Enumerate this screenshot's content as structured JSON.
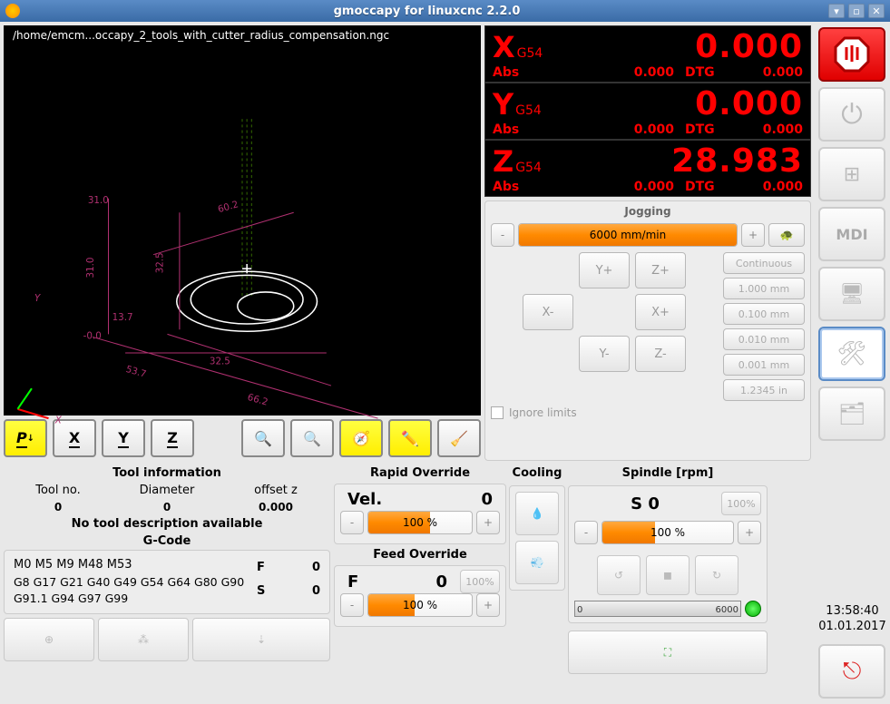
{
  "window": {
    "title": "gmoccapy for linuxcnc  2.2.0",
    "min": "▾",
    "restore": "▫",
    "close": "✕"
  },
  "preview": {
    "filepath": "/home/emcm...occapy_2_tools_with_cutter_radius_compensation.ngc",
    "dims": [
      "31.0",
      "31.0",
      "60.2",
      "32.5",
      "53.7",
      "32.5",
      "66.2",
      "13.7",
      "-0.0",
      "Y",
      "X"
    ]
  },
  "dro": {
    "rows": [
      {
        "axis": "X",
        "sub": "G54",
        "val": "0.000",
        "abs": "Abs",
        "v1": "0.000",
        "dtg": "DTG",
        "v2": "0.000"
      },
      {
        "axis": "Y",
        "sub": "G54",
        "val": "0.000",
        "abs": "Abs",
        "v1": "0.000",
        "dtg": "DTG",
        "v2": "0.000"
      },
      {
        "axis": "Z",
        "sub": "G54",
        "val": "28.983",
        "abs": "Abs",
        "v1": "0.000",
        "dtg": "DTG",
        "v2": "0.000"
      }
    ]
  },
  "jogging": {
    "title": "Jogging",
    "speed": "6000 mm/min",
    "fill": "100%",
    "minus": "-",
    "plus": "+",
    "btns": {
      "yp": "Y+",
      "zp": "Z+",
      "xm": "X-",
      "xp": "X+",
      "ym": "Y-",
      "zm": "Z-"
    },
    "steps": [
      "Continuous",
      "1.000 mm",
      "0.100 mm",
      "0.010 mm",
      "0.001 mm",
      "1.2345 in"
    ],
    "ignore": "Ignore limits"
  },
  "toolbar": {
    "p": "P",
    "x": "X",
    "y": "Y",
    "z": "Z"
  },
  "toolinfo": {
    "title": "Tool information",
    "hdr": {
      "no": "Tool no.",
      "dia": "Diameter",
      "off": "offset z"
    },
    "val": {
      "no": "0",
      "dia": "0",
      "off": "0.000"
    },
    "desc": "No tool description available"
  },
  "gcode": {
    "title": "G-Code",
    "line1": "M0 M5 M9 M48 M53",
    "line2": "G8 G17 G21 G40 G49 G54 G64 G80 G90 G91.1 G94 G97 G99",
    "F": "F",
    "Fval": "0",
    "S": "S",
    "Sval": "0"
  },
  "rapid": {
    "title": "Rapid Override",
    "lbl": "Vel.",
    "val": "0",
    "pct": "100 %",
    "fill": "60%",
    "reset": "100%",
    "minus": "-",
    "plus": "+"
  },
  "feed": {
    "title": "Feed Override",
    "lbl": "F",
    "val": "0",
    "pct": "100 %",
    "fill": "45%",
    "reset": "100%",
    "minus": "-",
    "plus": "+"
  },
  "cooling": {
    "title": "Cooling"
  },
  "spindle": {
    "title": "Spindle [rpm]",
    "vel": "S 0",
    "reset": "100%",
    "pct": "100 %",
    "fill": "40%",
    "minus": "-",
    "plus": "+",
    "bar0": "0",
    "bar1": "6000"
  },
  "clock": {
    "time": "13:58:40",
    "date": "01.01.2017"
  },
  "rightbar": {
    "mdi": "MDI"
  }
}
